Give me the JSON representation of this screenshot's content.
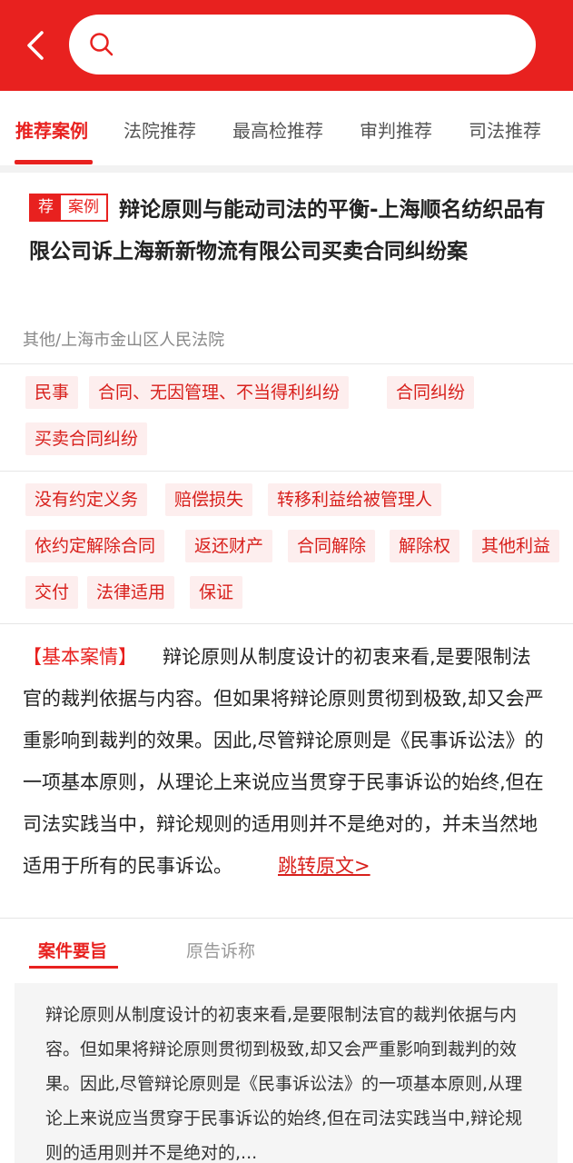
{
  "search": {
    "placeholder": ""
  },
  "tabs": [
    "推荐案例",
    "法院推荐",
    "最高检推荐",
    "审判推荐",
    "司法推荐"
  ],
  "case": {
    "badge_rec": "荐",
    "badge_type": "案例",
    "title": "辩论原则与能动司法的平衡-上海顺名纺织品有限公司诉上海新新物流有限公司买卖合同纠纷案",
    "court": "其他/上海市金山区人民法院"
  },
  "cause_tags": [
    "民事",
    "合同、无因管理、不当得利纠纷",
    "合同纠纷",
    "买卖合同纠纷"
  ],
  "keyword_tags": [
    "没有约定义务",
    "赔偿损失",
    "转移利益给被管理人",
    "依约定解除合同",
    "返还财产",
    "合同解除",
    "解除权",
    "其他利益",
    "交付",
    "法律适用",
    "保证"
  ],
  "basic": {
    "label": "【基本案情】",
    "text": "辩论原则从制度设计的初衷来看,是要限制法官的裁判依据与内容。但如果将辩论原则贯彻到极致,却又会严重影响到裁判的效果。因此,尽管辩论原则是《民事诉讼法》的一项基本原则，从理论上来说应当贯穿于民事诉讼的始终,但在司法实践当中，辩论规则的适用则并不是绝对的，并未当然地适用于所有的民事诉讼。",
    "link": "跳转原文>"
  },
  "detail_tabs": [
    "案件要旨",
    "原告诉称"
  ],
  "gist": "辩论原则从制度设计的初衷来看,是要限制法官的裁判依据与内容。但如果将辩论原则贯彻到极致,却又会严重影响到裁判的效果。因此,尽管辩论原则是《民事诉讼法》的一项基本原则,从理论上来说应当贯穿于民事诉讼的始终,但在司法实践当中,辩论规则的适用则并不是绝对的,...",
  "colors": {
    "accent": "#e8211f",
    "tag_bg": "#fdeeee"
  },
  "icons": {
    "back": "back-arrow-icon",
    "search": "search-icon"
  }
}
